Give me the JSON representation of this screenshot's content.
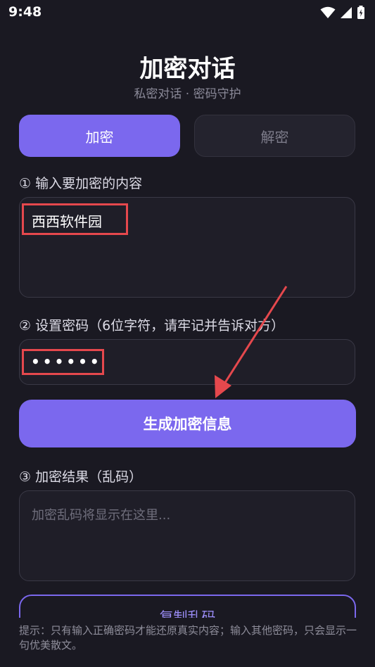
{
  "status": {
    "time": "9:48"
  },
  "header": {
    "title": "加密对话",
    "subtitle": "私密对话 · 密码守护"
  },
  "tabs": [
    {
      "label": "加密"
    },
    {
      "label": "解密"
    }
  ],
  "step1": {
    "label": "① 输入要加密的内容",
    "value": "西西软件园"
  },
  "step2": {
    "label": "② 设置密码（6位字符，请牢记并告诉对方）",
    "value": "••••••"
  },
  "generate_button": {
    "label": "生成加密信息"
  },
  "step3": {
    "label": "③ 加密结果（乱码）",
    "placeholder": "加密乱码将显示在这里..."
  },
  "copy_button": {
    "label": "复制乱码"
  },
  "hint": {
    "text": "提示：只有输入正确密码才能还原真实内容；输入其他密码，只会显示一句优美散文。"
  },
  "colors": {
    "accent": "#7b68ee",
    "background": "#1a1922",
    "highlight": "#e5484d"
  }
}
